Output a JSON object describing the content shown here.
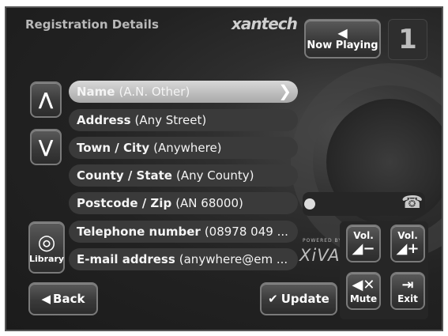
{
  "header": {
    "title": "Registration Details",
    "brand": "xantech"
  },
  "now_playing": {
    "label": "Now Playing",
    "zone_number": "1"
  },
  "nav": {
    "up_symbol": "⋀",
    "down_symbol": "⋁"
  },
  "fields": [
    {
      "label": "Name",
      "value": "(A.N. Other)",
      "selected": true
    },
    {
      "label": "Address",
      "value": "(Any Street)"
    },
    {
      "label": "Town / City",
      "value": "(Anywhere)"
    },
    {
      "label": "County / State",
      "value": "(Any County)"
    },
    {
      "label": "Postcode / Zip",
      "value": "(AN 68000)"
    },
    {
      "label": "Telephone number",
      "value": "(08978 049 ..."
    },
    {
      "label": "E-mail address",
      "value": "(anywhere@em ..."
    }
  ],
  "library": {
    "label": "Library"
  },
  "logo": {
    "powered_by": "POWERED BY",
    "name": "XiVA"
  },
  "volume": {
    "down_label": "Vol.",
    "up_label": "Vol.",
    "mute_label": "Mute",
    "exit_label": "Exit"
  },
  "actions": {
    "back_label": "Back",
    "update_label": "Update"
  },
  "icons": [
    "speaker-icon",
    "chevron-right-icon",
    "disc-stack-icon",
    "phone-icon",
    "mute-icon",
    "exit-icon",
    "back-arrow-icon",
    "checkmark-icon"
  ]
}
